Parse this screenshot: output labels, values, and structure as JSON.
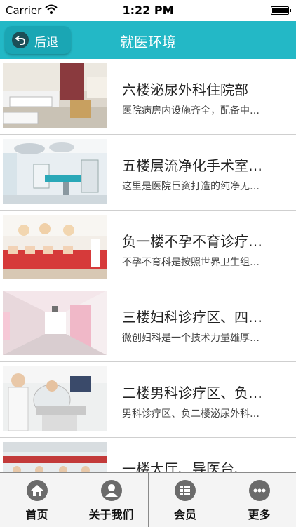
{
  "status": {
    "carrier": "Carrier",
    "time": "1:22 PM"
  },
  "nav": {
    "back_label": "后退",
    "title": "就医环境"
  },
  "items": [
    {
      "title": "六楼泌尿外科住院部",
      "desc": "医院病房内设施齐全，配备中…"
    },
    {
      "title": "五楼层流净化手术室…",
      "desc": "这里是医院巨资打造的纯净无…"
    },
    {
      "title": "负一楼不孕不育诊疗…",
      "desc": "不孕不育科是按照世界卫生组…"
    },
    {
      "title": "三楼妇科诊疗区、四…",
      "desc": "微创妇科是一个技术力量雄厚…"
    },
    {
      "title": "二楼男科诊疗区、负…",
      "desc": "男科诊疗区、负二楼泌尿外科…"
    },
    {
      "title": "一楼大厅、导医台、…",
      "desc": ""
    }
  ],
  "tabs": [
    {
      "label": "首页",
      "icon": "home-icon"
    },
    {
      "label": "关于我们",
      "icon": "user-icon"
    },
    {
      "label": "会员",
      "icon": "grid-icon"
    },
    {
      "label": "更多",
      "icon": "more-icon"
    }
  ],
  "colors": {
    "accent": "#23b8c6",
    "tab_icon": "#6b6b6b"
  }
}
